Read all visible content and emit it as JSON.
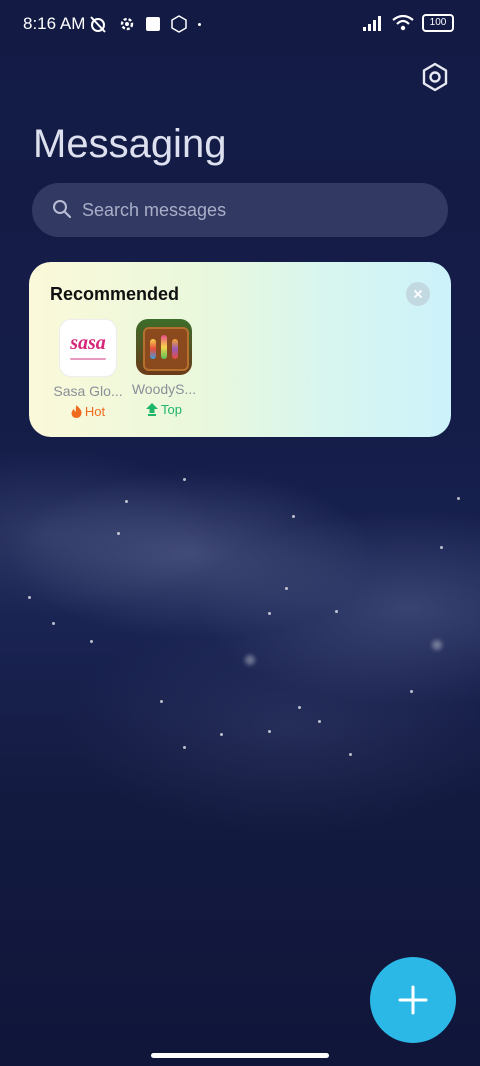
{
  "status_bar": {
    "time": "8:16 AM",
    "battery": "100"
  },
  "header": {
    "title": "Messaging"
  },
  "search": {
    "placeholder": "Search messages"
  },
  "recommended": {
    "heading": "Recommended",
    "apps": [
      {
        "name": "Sasa Glo...",
        "logo_text": "sasa",
        "tag": "Hot",
        "tag_icon": "flame-icon",
        "tag_color": "#ef6a1c"
      },
      {
        "name": "WoodyS...",
        "tag": "Top",
        "tag_icon": "arrow-up-icon",
        "tag_color": "#1fb56a"
      }
    ]
  },
  "colors": {
    "background": "#121a3f",
    "fab": "#2cb8e6"
  }
}
